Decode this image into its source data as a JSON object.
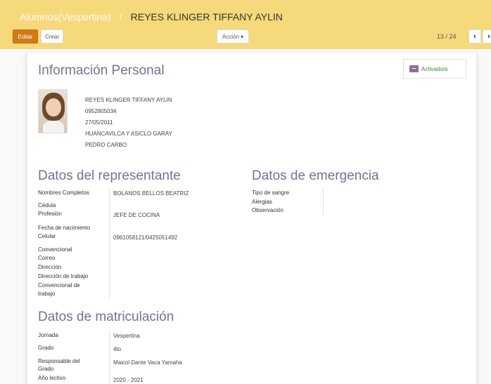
{
  "breadcrumb": {
    "parent": "Alumnos(Vespertina)",
    "separator": "/",
    "current": "REYES KLINGER TIFFANY AYLIN"
  },
  "toolbar": {
    "edit_label": "Editar",
    "create_label": "Crear",
    "action_label": "Acción ▾"
  },
  "pager": {
    "value": "13 / 24",
    "prev_icon": "chevron-left-icon",
    "next_icon": "chevron-right-icon"
  },
  "status": {
    "label": "Activado/a",
    "icon": "archive-icon"
  },
  "personal": {
    "title": "Información Personal",
    "name": "REYES KLINGER TIFFANY AYLIN",
    "id_number": "0952805034",
    "birth_date": "27/05/2011",
    "address": "HUANCAVILCA Y ASICLO GARAY",
    "city": "PEDRO CARBO"
  },
  "representative": {
    "title": "Datos del representante",
    "labels": {
      "names": "Nombres Completos",
      "cedula": "Cédula",
      "profession": "Profesión",
      "birth_date": "Fecha de nacimiento",
      "cell": "Celular",
      "landline": "Convencional",
      "email": "Correo",
      "address": "Dirección",
      "work_address": "Dirección de trabajo",
      "work_landline": "Convencional de trabajo"
    },
    "values": {
      "names": "BOLANOS BELLOS BEATRIZ",
      "profession": "JEFE DE COCINA",
      "cell": "0961058121/0425051492"
    }
  },
  "emergency": {
    "title": "Datos de emergencia",
    "labels": {
      "blood_type": "Tipo de sangre",
      "allergies": "Alergias",
      "observation": "Observación"
    }
  },
  "enrollment": {
    "title": "Datos de matriculación",
    "labels": {
      "shift": "Jornada",
      "grade": "Grado",
      "grade_manager": "Responsable del Grado",
      "school_year": "Año lectivo"
    },
    "values": {
      "shift": "Vespertina",
      "grade": "4to",
      "grade_manager": "Maicol Dante Vaca Yamaha",
      "school_year": "2020 - 2021"
    }
  },
  "colors": {
    "header_bg": "#f6d97a",
    "primary_button": "#d17b15",
    "section_title": "#7a6f93",
    "status_active": "#2c8a3e"
  }
}
